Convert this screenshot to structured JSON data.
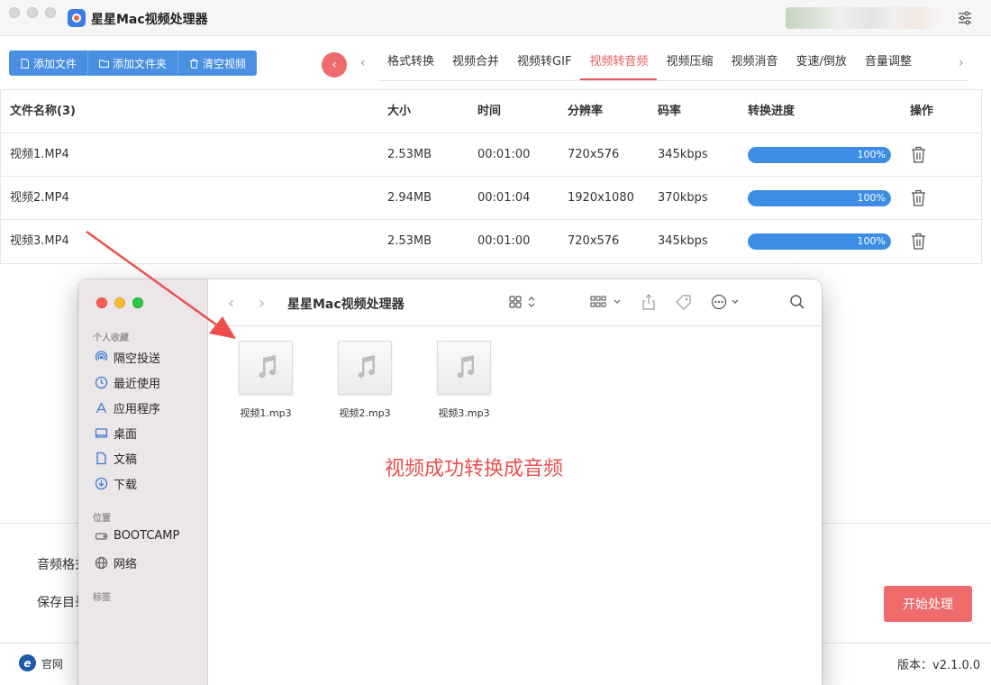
{
  "app": {
    "title": "星星Mac视频处理器"
  },
  "toolbar": {
    "add_file": "添加文件",
    "add_folder": "添加文件夹",
    "clear": "清空视频"
  },
  "tabs": [
    "格式转换",
    "视频合并",
    "视频转GIF",
    "视频转音频",
    "视频压缩",
    "视频消音",
    "变速/倒放",
    "音量调整"
  ],
  "active_tab": "视频转音频",
  "table": {
    "headers": [
      "文件名称(3)",
      "大小",
      "时间",
      "分辨率",
      "码率",
      "转换进度",
      "操作"
    ],
    "rows": [
      {
        "name": "视频1.MP4",
        "size": "2.53MB",
        "time": "00:01:00",
        "resolution": "720x576",
        "bitrate": "345kbps",
        "progress": "100%",
        "progress_value": 1.0
      },
      {
        "name": "视频2.MP4",
        "size": "2.94MB",
        "time": "00:01:04",
        "resolution": "1920x1080",
        "bitrate": "370kbps",
        "progress": "100%",
        "progress_value": 1.0
      },
      {
        "name": "视频3.MP4",
        "size": "2.53MB",
        "time": "00:01:00",
        "resolution": "720x576",
        "bitrate": "345kbps",
        "progress": "100%",
        "progress_value": 1.0
      }
    ]
  },
  "settings": {
    "audio_format_label": "音频格式",
    "save_dir_label": "保存目录"
  },
  "start_button": "开始处理",
  "footer": {
    "site_label": "官网",
    "version": "版本：v2.1.0.0"
  },
  "finder": {
    "title": "星星Mac视频处理器",
    "sidebar": {
      "favorites_header": "个人收藏",
      "favorites": [
        {
          "label": "隔空投送",
          "icon": "airdrop-icon"
        },
        {
          "label": "最近使用",
          "icon": "clock-icon"
        },
        {
          "label": "应用程序",
          "icon": "apps-icon"
        },
        {
          "label": "桌面",
          "icon": "desktop-icon"
        },
        {
          "label": "文稿",
          "icon": "document-icon"
        },
        {
          "label": "下载",
          "icon": "download-icon"
        }
      ],
      "locations_header": "位置",
      "locations": [
        {
          "label": "BOOTCAMP",
          "icon": "drive-icon"
        },
        {
          "label": "网络",
          "icon": "globe-icon"
        }
      ],
      "tags_header": "标签"
    },
    "files": [
      "视频1.mp3",
      "视频2.mp3",
      "视频3.mp3"
    ],
    "annotation": "视频成功转换成音频"
  },
  "colors": {
    "primary_blue": "#4a90e2",
    "accent_red": "#e75a5a",
    "progress_blue": "#3d8de6"
  }
}
